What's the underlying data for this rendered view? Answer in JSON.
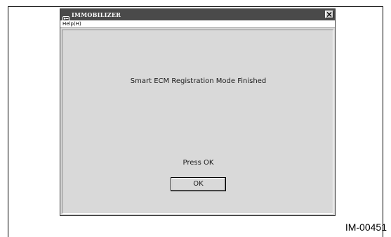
{
  "window": {
    "title": "IMMOBILIZER",
    "app_icon": "car-key-icon",
    "close_icon": "close-icon"
  },
  "menu": {
    "help_label": "Help(H)"
  },
  "dialog": {
    "message": "Smart ECM Registration Mode Finished",
    "prompt": "Press OK",
    "ok_label": "OK"
  },
  "figure": {
    "code": "IM-00451"
  },
  "colors": {
    "titlebar": "#4a4a4a",
    "window_face": "#d9d9d9",
    "menubar": "#ffffff"
  }
}
